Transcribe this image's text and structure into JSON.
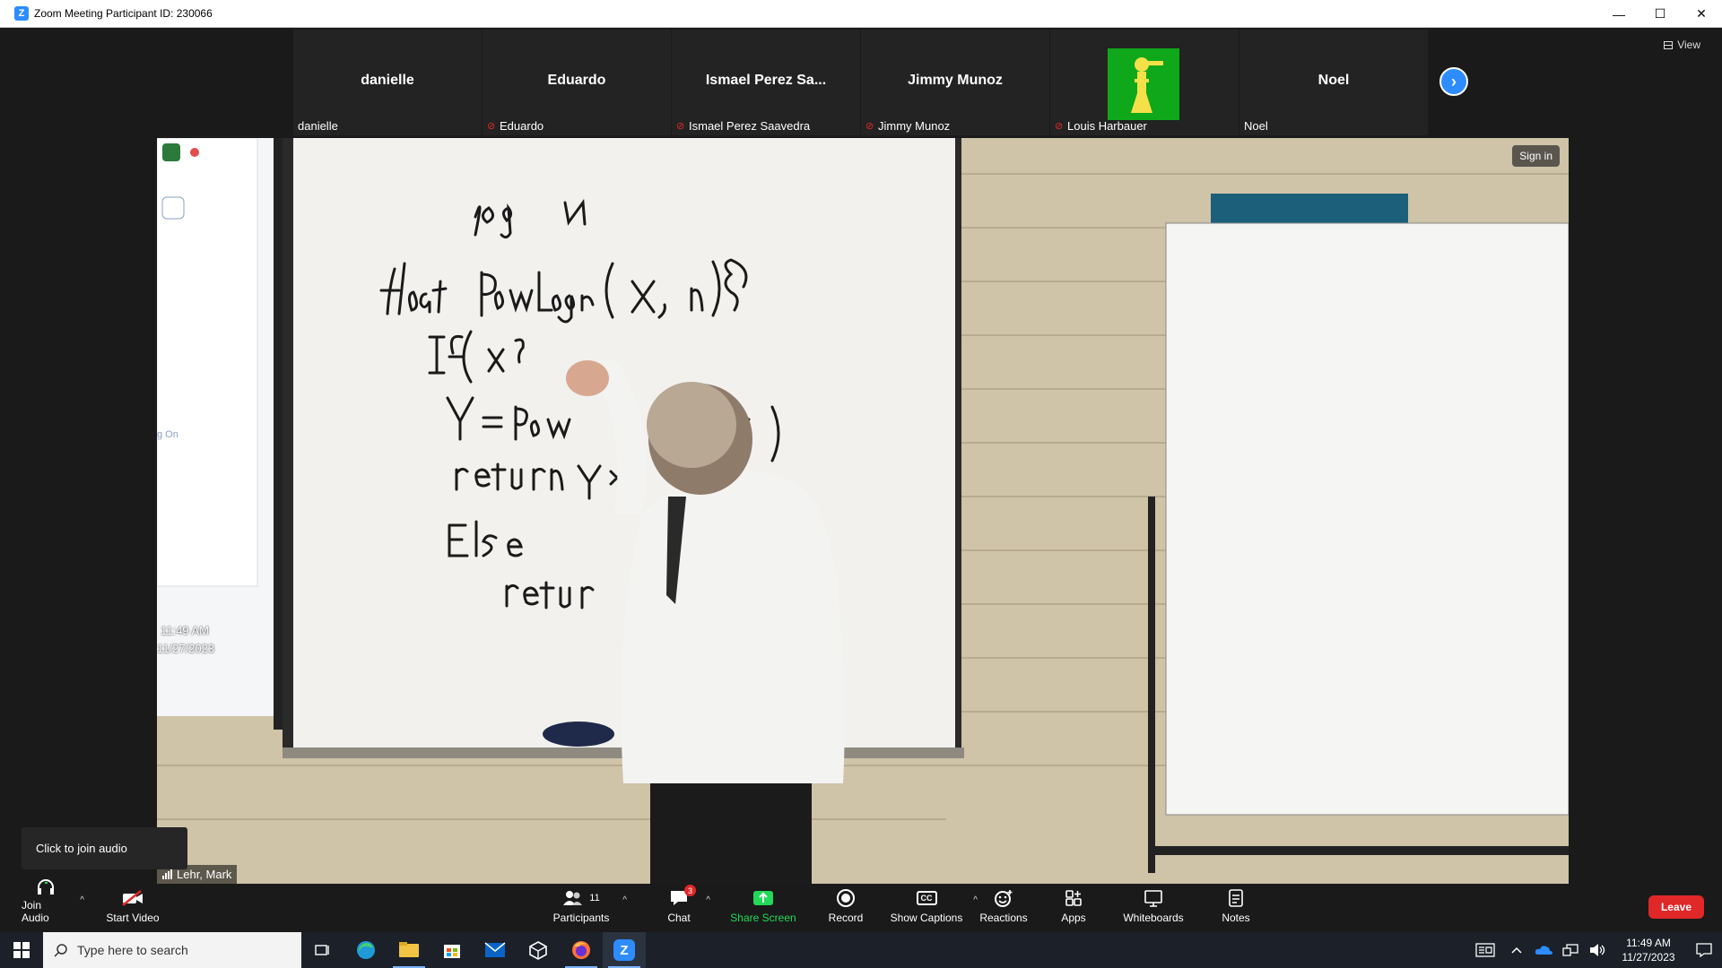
{
  "window": {
    "title": "Zoom Meeting Participant ID: 230066",
    "logo_letter": "Z",
    "minimize": "—",
    "maximize": "☐",
    "close": "✕"
  },
  "view_button": {
    "label": "View"
  },
  "participants_strip": [
    {
      "big_name": "danielle",
      "label": "danielle",
      "muted": false,
      "avatar": false
    },
    {
      "big_name": "Eduardo",
      "label": "Eduardo",
      "muted": true,
      "avatar": false
    },
    {
      "big_name": "Ismael Perez Sa...",
      "label": "Ismael Perez Saavedra",
      "muted": true,
      "avatar": false
    },
    {
      "big_name": "Jimmy Munoz",
      "label": "Jimmy Munoz",
      "muted": true,
      "avatar": false
    },
    {
      "big_name": "",
      "label": "Louis Harbauer",
      "muted": true,
      "avatar": true
    },
    {
      "big_name": "Noel",
      "label": "Noel",
      "muted": false,
      "avatar": false
    }
  ],
  "main_video": {
    "sign_in": "Sign in",
    "speaker_name": "Lehr, Mark",
    "whiteboard_lines": [
      "log N",
      "float powLogn(x, n) {",
      "If(x ? ... = =",
      "Y = pow ... n/2)",
      "return Y *",
      "Else",
      "return ... n(x,n)"
    ],
    "embedded_time": "11:49 AM",
    "embedded_date": "11/27/2023",
    "embedded_sign_on": "g On"
  },
  "tooltip": {
    "text": "Click to join audio"
  },
  "toolbar": {
    "join_audio": "Join Audio",
    "start_video": "Start Video",
    "participants": "Participants",
    "participants_count": "11",
    "chat": "Chat",
    "chat_badge": "3",
    "share_screen": "Share Screen",
    "record": "Record",
    "show_captions": "Show Captions",
    "reactions": "Reactions",
    "apps": "Apps",
    "whiteboards": "Whiteboards",
    "notes": "Notes",
    "leave": "Leave",
    "captions_icon": "CC"
  },
  "taskbar": {
    "search_placeholder": "Type here to search",
    "time": "11:49 AM",
    "date": "11/27/2023",
    "zoom_letter": "Z"
  },
  "colors": {
    "accent": "#2d8cff",
    "leave": "#e02828",
    "share": "#23d959",
    "bg": "#1a1a1a"
  }
}
